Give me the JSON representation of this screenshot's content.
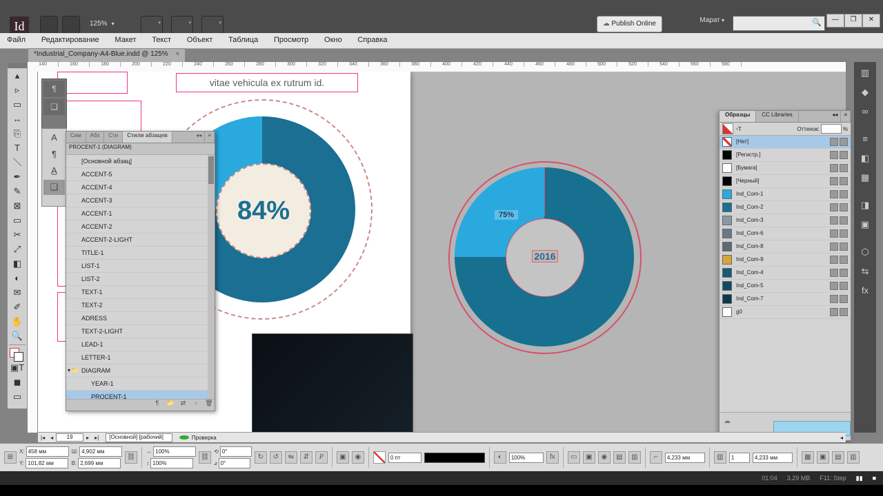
{
  "app": {
    "logo": "Id",
    "zoom": "125%",
    "publish": "Publish Online",
    "user": "Марат",
    "doc_tab": "*Industrial_Company-A4-Blue.indd @ 125%"
  },
  "win": {
    "min": "—",
    "max": "❐",
    "close": "✕"
  },
  "menu": [
    "Файл",
    "Редактирование",
    "Макет",
    "Текст",
    "Объект",
    "Таблица",
    "Просмотр",
    "Окно",
    "Справка"
  ],
  "ruler": [
    "140",
    "160",
    "180",
    "200",
    "220",
    "240",
    "260",
    "280",
    "300",
    "320",
    "340",
    "360",
    "380",
    "400",
    "420",
    "440",
    "460",
    "480",
    "500",
    "520",
    "540",
    "560",
    "580"
  ],
  "page": {
    "textbox": "vitae vehicula ex rutrum id.",
    "center1": "84%",
    "center2": "2016",
    "label2": "75%"
  },
  "styles": {
    "tabs": [
      "Сим",
      "Абз",
      "Сти",
      "Стили абзацев"
    ],
    "caption": "PROCENT-1 (DIAGRAM)",
    "items": [
      {
        "t": "[Основной абзац]",
        "i": 1
      },
      {
        "t": "ACCENT-5",
        "i": 1
      },
      {
        "t": "ACCENT-4",
        "i": 1
      },
      {
        "t": "ACCENT-3",
        "i": 1
      },
      {
        "t": "ACCENT-1",
        "i": 1
      },
      {
        "t": "ACCENT-2",
        "i": 1
      },
      {
        "t": "ACCENT-2-LIGHT",
        "i": 1
      },
      {
        "t": "TITLE-1",
        "i": 1
      },
      {
        "t": "LIST-1",
        "i": 1
      },
      {
        "t": "LIST-2",
        "i": 1
      },
      {
        "t": "TEXT-1",
        "i": 1
      },
      {
        "t": "TEXT-2",
        "i": 1
      },
      {
        "t": "ADRESS",
        "i": 1
      },
      {
        "t": "TEXT-2-LIGHT",
        "i": 1
      },
      {
        "t": "LEAD-1",
        "i": 1
      },
      {
        "t": "LETTER-1",
        "i": 1
      },
      {
        "t": "DIAGRAM",
        "i": 0,
        "folder": true,
        "open": true
      },
      {
        "t": "YEAR-1",
        "i": 2
      },
      {
        "t": "PROCENT-1",
        "i": 2,
        "sel": true
      }
    ]
  },
  "swatches": {
    "tabs": [
      "Образцы",
      "CC Libraries"
    ],
    "label": "Оттенок:",
    "unit": "%",
    "items": [
      {
        "nm": "[Нет]",
        "c": "none",
        "sel": true
      },
      {
        "nm": "[Регистр.]",
        "c": "#000"
      },
      {
        "nm": "[Бумага]",
        "c": "#fff"
      },
      {
        "nm": "[Черный]",
        "c": "#000"
      },
      {
        "nm": "Ind_Com-1",
        "c": "#2aa9df"
      },
      {
        "nm": "Ind_Com-2",
        "c": "#1a6f93"
      },
      {
        "nm": "Ind_Com-3",
        "c": "#8a9aa5"
      },
      {
        "nm": "Ind_Com-6",
        "c": "#6a7a84"
      },
      {
        "nm": "Ind_Com-8",
        "c": "#5b6b74"
      },
      {
        "nm": "Ind_Com-9",
        "c": "#d9a43b"
      },
      {
        "nm": "Ind_Com-4",
        "c": "#155a76"
      },
      {
        "nm": "Ind_Com-5",
        "c": "#0f4a60"
      },
      {
        "nm": "Ind_Com-7",
        "c": "#0c3a4c"
      },
      {
        "nm": "g0",
        "c": "#fff"
      }
    ]
  },
  "pgbar": {
    "page": "19",
    "master": "[Основной] [рабочий]",
    "check": "Проверка"
  },
  "control": {
    "x": "458 мм",
    "y": "101,82 мм",
    "w": "4,902 мм",
    "h": "2,699 мм",
    "scale": "100%",
    "rot": "0°",
    "shear": "0°",
    "stroke": "0 пт",
    "gap": "4,233 мм",
    "cols": "1",
    "opac": "100%"
  },
  "status": {
    "time": "01:04",
    "size": "3.29 MB",
    "step": "F11: Step"
  },
  "chart_data": [
    {
      "type": "pie",
      "title": "",
      "series": [
        {
          "name": "light",
          "values": [
            25
          ]
        },
        {
          "name": "dark",
          "values": [
            75
          ]
        }
      ],
      "center_label": "84%",
      "note": "donut, left page"
    },
    {
      "type": "pie",
      "title": "",
      "series": [
        {
          "name": "light",
          "values": [
            25
          ]
        },
        {
          "name": "dark",
          "values": [
            75
          ]
        }
      ],
      "center_label": "2016",
      "slice_label": "75%",
      "note": "donut, right pasteboard"
    }
  ]
}
